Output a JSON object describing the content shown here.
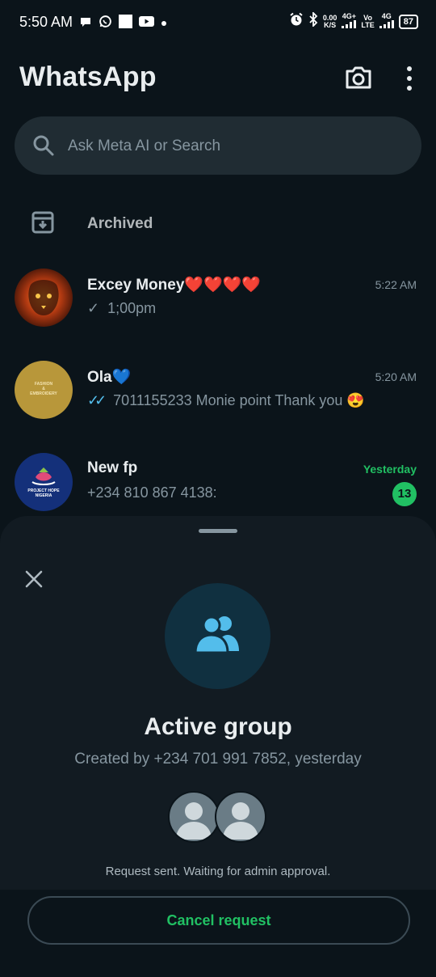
{
  "status_bar": {
    "time": "5:50 AM",
    "net_speed_top": "0.00",
    "net_speed_bottom": "K/S",
    "sim1": "4G+",
    "volte_top": "Vo",
    "volte_bottom": "LTE",
    "sim2": "4G",
    "battery": "87"
  },
  "header": {
    "title": "WhatsApp"
  },
  "search": {
    "placeholder": "Ask Meta AI or Search"
  },
  "archived": {
    "label": "Archived"
  },
  "chats": [
    {
      "name": "Excey Money❤️❤️❤️❤️",
      "tick": "✓",
      "message": "1;00pm",
      "time": "5:22 AM"
    },
    {
      "name": "Ola💙",
      "tick": "✓✓",
      "message": "7011155233 Monie point  Thank you 😍",
      "time": "5:20 AM"
    },
    {
      "name": "New fp",
      "message": "+234 810 867 4138:",
      "time": "Yesterday",
      "unread": "13"
    }
  ],
  "avatar_texts": {
    "ola_line1": "FASHION",
    "ola_line2": "&",
    "ola_line3": "EMBROIDERY",
    "newfp_line1": "PROJECT HOPE",
    "newfp_line2": "NIGERIA"
  },
  "sheet": {
    "title": "Active group",
    "subtitle": "Created by +234 701 991 7852, yesterday",
    "request_status": "Request sent. Waiting for admin approval.",
    "cancel_label": "Cancel request"
  },
  "colors": {
    "background": "#0b141a",
    "accent_green": "#21c063",
    "icon_blue": "#53bdeb",
    "sheet_bg": "#121b22"
  }
}
